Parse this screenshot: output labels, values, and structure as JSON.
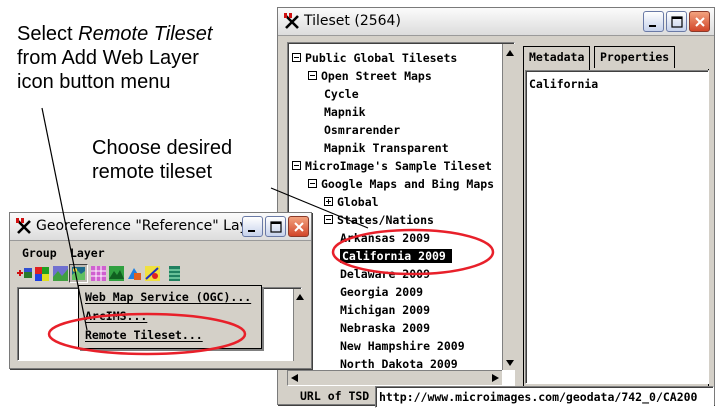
{
  "annotations": {
    "select_line1_prefix": "Select ",
    "select_line1_italic": "Remote Tileset",
    "select_line2": "from Add Web Layer",
    "select_line3": "icon button menu",
    "choose_line1": "Choose desired",
    "choose_line2": "remote tileset"
  },
  "tileset_window": {
    "title": "Tileset (2564)",
    "tree": [
      {
        "label": "Public Global Tilesets",
        "expander": "minus"
      },
      {
        "label": "Open Street Maps",
        "expander": "minus"
      },
      {
        "label": "Cycle"
      },
      {
        "label": "Mapnik"
      },
      {
        "label": "Osmrarender"
      },
      {
        "label": "Mapnik Transparent"
      },
      {
        "label": "MicroImage's Sample Tileset",
        "expander": "minus"
      },
      {
        "label": "Google Maps and Bing Maps",
        "expander": "minus"
      },
      {
        "label": "Global",
        "expander": "plus"
      },
      {
        "label": "States/Nations",
        "expander": "minus"
      },
      {
        "label": "Arkansas 2009"
      },
      {
        "label": "California 2009",
        "selected": true
      },
      {
        "label": "Delaware 2009"
      },
      {
        "label": "Georgia 2009"
      },
      {
        "label": "Michigan 2009"
      },
      {
        "label": "Nebraska 2009"
      },
      {
        "label": "New Hampshire 2009"
      },
      {
        "label": "North Dakota 2009"
      }
    ],
    "tabs": {
      "metadata": "Metadata",
      "properties": "Properties"
    },
    "metadata_text": "California",
    "url_label": "URL of TSD",
    "url_value": "http://www.microimages.com/geodata/742_0/CA200"
  },
  "georef_window": {
    "title": "Georeference \"Reference\" Lay...",
    "menu": {
      "group": "Group",
      "layer": "Layer"
    },
    "dropdown": [
      "Web Map Service (OGC)...",
      "ArcIMS...",
      "Remote Tileset..."
    ]
  },
  "colors": {
    "highlight_ellipse": "#e8202a",
    "selection": "#000000",
    "panel": "#d4d0c8"
  },
  "icons": {
    "app": "microimages-x-icon"
  }
}
